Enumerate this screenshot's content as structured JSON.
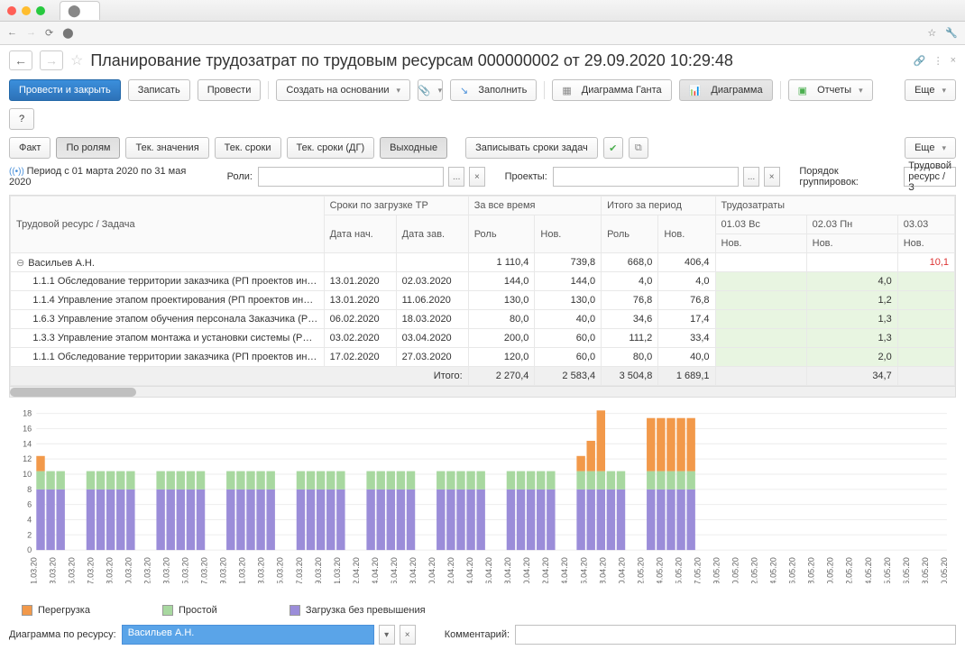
{
  "browser": {
    "tab_icon": "⬤"
  },
  "title": "Планирование трудозатрат по трудовым ресурсам 000000002 от 29.09.2020 10:29:48",
  "toolbar": {
    "process_close": "Провести и закрыть",
    "write": "Записать",
    "process": "Провести",
    "create_based": "Создать на основании",
    "fill": "Заполнить",
    "gantt": "Диаграмма Ганта",
    "diagram": "Диаграмма",
    "reports": "Отчеты",
    "more": "Еще",
    "help": "?"
  },
  "tabs": {
    "fact": "Факт",
    "by_roles": "По ролям",
    "cur_values": "Тек. значения",
    "cur_dates": "Тек. сроки",
    "cur_dates_dg": "Тек. сроки (ДГ)",
    "weekends": "Выходные",
    "write_task_dates": "Записывать сроки задач",
    "more": "Еще"
  },
  "filters": {
    "period": "Период с 01 марта 2020 по 31 мая 2020",
    "roles_label": "Роли:",
    "projects_label": "Проекты:",
    "grouping_label": "Порядок группировок:",
    "grouping_value": "Трудовой ресурс / З"
  },
  "table": {
    "h_resource": "Трудовой ресурс / Задача",
    "h_dates": "Сроки по загрузке ТР",
    "h_alltime": "За все время",
    "h_period_total": "Итого за период",
    "h_labor": "Трудозатраты",
    "h_start": "Дата нач.",
    "h_end": "Дата зав.",
    "h_role": "Роль",
    "h_new": "Нов.",
    "h_d1": "01.03 Вс",
    "h_d2": "02.03 Пн",
    "h_d3": "03.03",
    "total_label": "Итого:",
    "rows": [
      {
        "name": "Васильев А.Н.",
        "expand": "⊖",
        "role_all": "1 110,4",
        "new_all": "739,8",
        "role_p": "668,0",
        "new_p": "406,4",
        "d3": "10,1",
        "red": true
      },
      {
        "name": "1.1.1 Обследование территории заказчика (РП проектов инжин...",
        "start": "13.01.2020",
        "end": "02.03.2020",
        "role_all": "144,0",
        "new_all": "144,0",
        "role_p": "4,0",
        "new_p": "4,0",
        "d2": "4,0",
        "g": true
      },
      {
        "name": "1.1.4 Управление этапом проектирования (РП проектов инжини...",
        "start": "13.01.2020",
        "end": "11.06.2020",
        "role_all": "130,0",
        "new_all": "130,0",
        "role_p": "76,8",
        "new_p": "76,8",
        "d2": "1,2",
        "g": true
      },
      {
        "name": "1.6.3 Управление этапом обучения персонала Заказчика (РП пр...",
        "start": "06.02.2020",
        "end": "18.03.2020",
        "role_all": "80,0",
        "new_all": "40,0",
        "role_p": "34,6",
        "new_p": "17,4",
        "d2": "1,3",
        "g": true
      },
      {
        "name": "1.3.3 Управление этапом монтажа и установки системы (РП про...",
        "start": "03.02.2020",
        "end": "03.04.2020",
        "role_all": "200,0",
        "new_all": "60,0",
        "role_p": "111,2",
        "new_p": "33,4",
        "d2": "1,3",
        "g": true
      },
      {
        "name": "1.1.1 Обследование территории заказчика (РП проектов инжин...",
        "start": "17.02.2020",
        "end": "27.03.2020",
        "role_all": "120,0",
        "new_all": "60,0",
        "role_p": "80,0",
        "new_p": "40,0",
        "d2": "2,0",
        "g": true
      }
    ],
    "totals": {
      "role_all": "2 270,4",
      "new_all": "2 583,4",
      "role_p": "3 504,8",
      "new_p": "1 689,1",
      "d2": "34,7"
    }
  },
  "chart_data": {
    "type": "bar",
    "ylim": [
      0,
      18
    ],
    "yticks": [
      0,
      2,
      4,
      6,
      8,
      10,
      12,
      14,
      16,
      18
    ],
    "categories": [
      "01.03.20",
      "03.03.20",
      "05.03.20",
      "07.03.20",
      "08.03.20",
      "10.03.20",
      "12.03.20",
      "13.03.20",
      "15.03.20",
      "17.03.20",
      "19.03.20",
      "21.03.20",
      "23.03.20",
      "25.03.20",
      "27.03.20",
      "29.03.20",
      "31.03.20",
      "02.04.20",
      "04.04.20",
      "06.04.20",
      "08.04.20",
      "10.04.20",
      "12.04.20",
      "14.04.20",
      "16.04.20",
      "18.04.20",
      "20.04.20",
      "22.04.20",
      "24.04.20",
      "26.04.20",
      "28.04.20",
      "30.04.20",
      "02.05.20",
      "04.05.20",
      "05.05.20",
      "07.05.20",
      "09.05.20",
      "10.05.20",
      "12.05.20",
      "14.05.20",
      "16.05.20",
      "18.05.20",
      "20.05.20",
      "22.05.20",
      "24.05.20",
      "25.05.20",
      "26.05.20",
      "28.05.20",
      "30.05.20"
    ],
    "series": [
      {
        "name": "Загрузка без превышения",
        "color": "#9b8dd9",
        "values": [
          8,
          8,
          8,
          null,
          null,
          8,
          8,
          8,
          8,
          8,
          null,
          null,
          8,
          8,
          8,
          8,
          8,
          null,
          null,
          8,
          8,
          8,
          8,
          8,
          null,
          null,
          8,
          8,
          8,
          8,
          8,
          null,
          null,
          8,
          8,
          8,
          8,
          8,
          null,
          null,
          8,
          8,
          8,
          8,
          8,
          null,
          null,
          8,
          8,
          8,
          8,
          8,
          null,
          null,
          8,
          8,
          8,
          8,
          8,
          null,
          null,
          8,
          8,
          8,
          8,
          8
        ]
      },
      {
        "name": "Простой",
        "color": "#a8d8a0",
        "values": [
          0,
          0,
          0,
          null,
          null,
          0,
          0,
          0,
          0,
          0,
          null,
          null,
          0,
          0,
          0,
          0,
          0,
          null,
          null,
          0,
          0,
          0,
          0,
          0,
          null,
          null,
          0,
          0,
          0,
          0,
          0,
          null,
          null,
          0,
          0,
          0,
          0,
          0,
          null,
          null,
          0,
          0,
          0,
          0,
          0,
          null,
          null,
          0,
          0,
          0,
          0,
          0,
          null,
          null,
          0,
          0,
          0,
          0,
          0,
          null,
          null,
          0,
          0,
          0,
          0,
          0
        ]
      },
      {
        "name": "Перегрузка",
        "color": "#f2994a",
        "values": [
          2,
          0,
          0,
          null,
          null,
          0,
          0,
          0,
          0,
          0,
          null,
          null,
          0,
          0,
          0,
          0,
          0,
          null,
          null,
          0,
          0,
          0,
          0,
          0,
          null,
          null,
          0,
          0,
          0,
          0,
          0,
          null,
          null,
          0,
          0,
          0,
          0,
          0,
          null,
          null,
          0,
          0,
          0,
          0,
          0,
          null,
          null,
          0,
          0,
          0,
          0,
          0,
          null,
          null,
          2,
          4,
          8,
          0,
          0,
          null,
          null,
          7,
          7,
          7,
          7,
          7
        ]
      }
    ],
    "legend": {
      "overload": "Перегрузка",
      "idle": "Простой",
      "normal": "Загрузка без превышения"
    }
  },
  "bottom": {
    "diagram_label": "Диаграмма по ресурсу:",
    "resource": "Васильев А.Н.",
    "comment_label": "Комментарий:"
  }
}
